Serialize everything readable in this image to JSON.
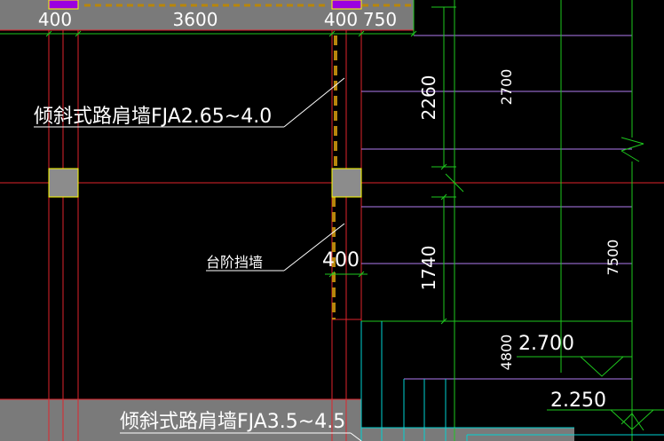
{
  "colors": {
    "background": "#000000",
    "axis_line": "#e0242c",
    "dimension_line": "#1ec81e",
    "purple_line": "#b07cf0",
    "cyan_line": "#00d2d2",
    "column_fill": "#8c8c8c",
    "column_stroke": "#ffff00",
    "dashed_wall": "#b8860b",
    "text": "#ffffff",
    "slab_fill": "#7a7a7a"
  },
  "dimensions": {
    "top": [
      "400",
      "3600",
      "400",
      "750"
    ],
    "right_short": [
      "2260",
      "1740"
    ],
    "right_long": [
      "2700",
      "7500"
    ],
    "bay": "400",
    "lower": "4800"
  },
  "annotations": {
    "label_upper": "倾斜式路肩墙FJA2.65~4.0",
    "label_step": "台阶挡墙",
    "label_lower": "倾斜式路肩墙FJA3.5~4.5"
  },
  "elevations": [
    "2.700",
    "2.250"
  ]
}
